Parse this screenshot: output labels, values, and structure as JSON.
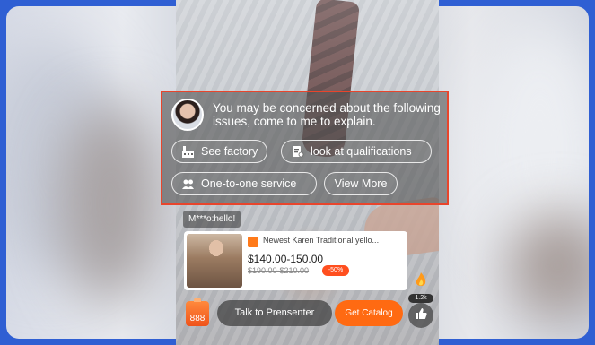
{
  "popup": {
    "message": "You may be concerned about the following issues, come to me to explain.",
    "chips": [
      {
        "label": "See factory",
        "icon": "factory-icon"
      },
      {
        "label": "look at qualifications",
        "icon": "certificate-icon"
      },
      {
        "label": "One-to-one service",
        "icon": "users-icon"
      },
      {
        "label": "View More",
        "icon": ""
      }
    ]
  },
  "chat": {
    "message": "M***o:hello!"
  },
  "product": {
    "title": "Newest Karen Traditional yello...",
    "price": "$140.00-150.00",
    "original_price": "$190.00-$210.00",
    "discount": "-50%"
  },
  "bottom_bar": {
    "gift_label": "888",
    "talk_label": "Talk to Prensenter",
    "catalog_label": "Get Catalog"
  },
  "likes": {
    "count": "1.2k"
  },
  "colors": {
    "accent": "#ff6a12",
    "highlight_border": "#e8452c",
    "background": "#2f5fd3"
  }
}
